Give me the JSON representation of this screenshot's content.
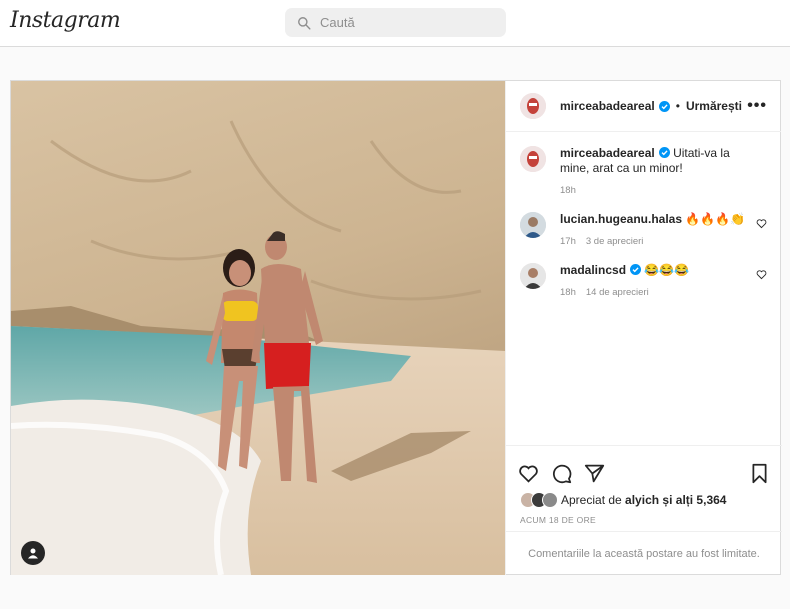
{
  "header": {
    "logo_text": "Instagram",
    "search_placeholder": "Caută"
  },
  "post": {
    "author": "mirceabadeareal",
    "separator": "•",
    "follow_label": "Urmărești",
    "more_label": "•••",
    "caption": {
      "user": "mirceabadeareal",
      "text": "Uitati-va la mine, arat ca un minor!",
      "time": "18h"
    },
    "comments": [
      {
        "user": "lucian.hugeanu.halas",
        "text": "🔥🔥🔥👏",
        "time": "17h",
        "likes": "3 de aprecieri"
      },
      {
        "user": "madalincsd",
        "text": "😂😂😂",
        "time": "18h",
        "likes": "14 de aprecieri"
      }
    ],
    "likes_prefix": "Apreciat de",
    "likes_user": "alyich",
    "likes_suffix": "și alți 5,364",
    "date": "ACUM 18 DE ORE",
    "comments_limited": "Comentariile la această postare au fost limitate."
  },
  "icons": [
    "search-icon",
    "verified-icon",
    "heart-icon",
    "comment-icon",
    "share-icon",
    "save-icon",
    "user-tag-icon"
  ],
  "colors": {
    "verified": "#0095f6",
    "border": "#dbdbdb",
    "muted": "#8e8e8e"
  }
}
